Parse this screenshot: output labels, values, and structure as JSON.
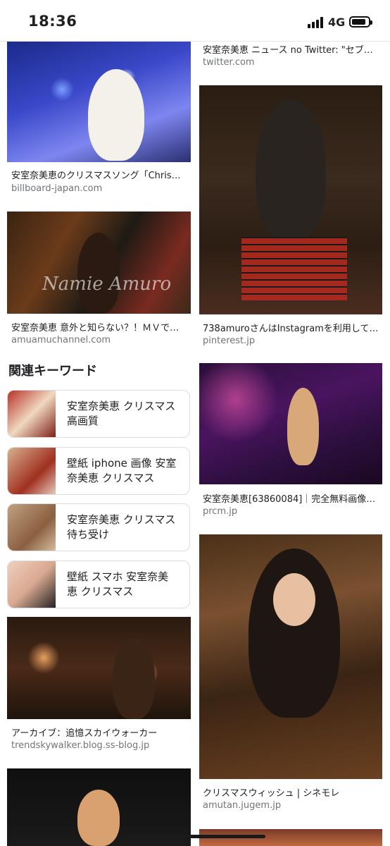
{
  "status_bar": {
    "time": "18:36",
    "network": "4G"
  },
  "results_left": [
    {
      "caption": "安室奈美恵のクリスマスソング「Chris…",
      "source": "billboard-japan.com"
    },
    {
      "caption": "安室奈美恵 意外と知らない？！ＭＶで…",
      "source": "amuamuchannel.com"
    },
    {
      "caption": "アーカイブ：追憶スカイウォーカー",
      "source": "trendskywalker.blog.ss-blog.jp"
    }
  ],
  "results_right": [
    {
      "caption": "安室奈美恵 ニュース no Twitter: \"セブ…",
      "source": "twitter.com"
    },
    {
      "caption": "738amuroさんはInstagramを利用して…",
      "source": "pinterest.jp"
    },
    {
      "caption": "安室奈美恵[63860084]｜完全無料画像…",
      "source": "prcm.jp"
    },
    {
      "caption": "クリスマスウィッシュ | シネモレ",
      "source": "amutan.jugem.jp"
    }
  ],
  "related": {
    "title": "関連キーワード",
    "items": [
      {
        "line1": "安室奈美恵 クリスマス",
        "line2": "高画質"
      },
      {
        "line1": "壁紙 iphone 画像 安室",
        "line2": "奈美恵 クリスマス"
      },
      {
        "line1": "安室奈美恵 クリスマス",
        "line2": "待ち受け"
      },
      {
        "line1": "壁紙 スマホ 安室奈美",
        "line2": "恵 クリスマス"
      }
    ]
  },
  "watermark": "Namie Amuro"
}
